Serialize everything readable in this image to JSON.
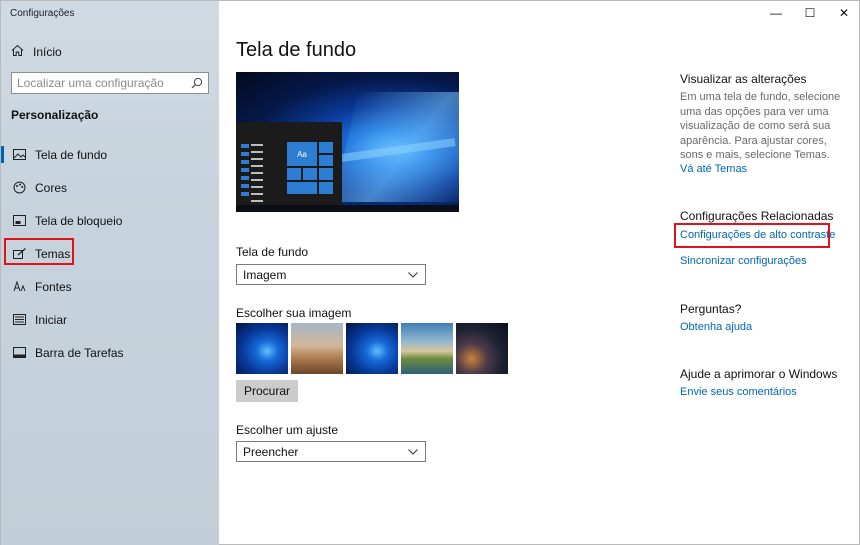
{
  "app_title": "Configurações",
  "sidebar": {
    "home_label": "Início",
    "search_placeholder": "Localizar uma configuração",
    "section_label": "Personalização",
    "items": [
      {
        "label": "Tela de fundo",
        "icon": "picture-icon",
        "active": true
      },
      {
        "label": "Cores",
        "icon": "palette-icon",
        "active": false
      },
      {
        "label": "Tela de bloqueio",
        "icon": "lock-screen-icon",
        "active": false
      },
      {
        "label": "Temas",
        "icon": "brush-icon",
        "active": false,
        "highlighted": true
      },
      {
        "label": "Fontes",
        "icon": "font-icon",
        "active": false
      },
      {
        "label": "Iniciar",
        "icon": "start-icon",
        "active": false
      },
      {
        "label": "Barra de Tarefas",
        "icon": "taskbar-icon",
        "active": false
      }
    ]
  },
  "window_controls": {
    "minimize": "—",
    "maximize": "☐",
    "close": "✕"
  },
  "main": {
    "title": "Tela de fundo",
    "preview_tile_text": "Aa",
    "background_label": "Tela de fundo",
    "background_value": "Imagem",
    "choose_image_label": "Escolher sua imagem",
    "browse_label": "Procurar",
    "fit_label": "Escolher um ajuste",
    "fit_value": "Preencher"
  },
  "right": {
    "preview_heading": "Visualizar as alterações",
    "preview_text": "Em uma tela de fundo, selecione uma das opções para ver uma visualização de como será sua aparência. Para ajustar cores, sons e mais, selecione Temas.",
    "themes_link": "Vá até Temas",
    "related_heading": "Configurações Relacionadas",
    "high_contrast_link": "Configurações de alto contraste",
    "sync_link": "Sincronizar configurações",
    "questions_heading": "Perguntas?",
    "help_link": "Obtenha ajuda",
    "improve_heading": "Ajude a aprimorar o Windows",
    "feedback_link": "Envie seus comentários"
  },
  "colors": {
    "accent": "#0063b1",
    "link": "#0067b8",
    "highlight": "#e0121c"
  }
}
